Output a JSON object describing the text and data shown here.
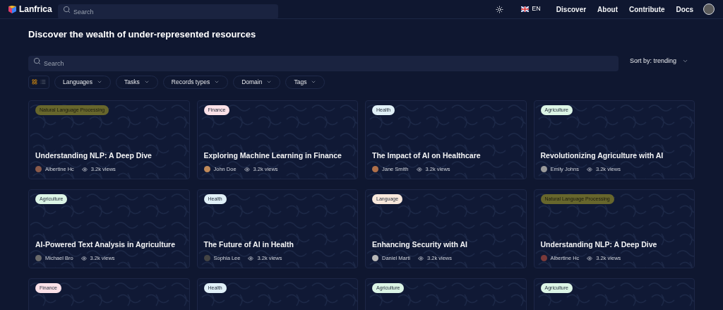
{
  "header": {
    "logo": "Lanfrica",
    "search_placeholder": "Search",
    "language": "EN",
    "nav": [
      "Discover",
      "About",
      "Contribute",
      "Docs"
    ]
  },
  "heading": "Discover the wealth of under-represented resources",
  "search": {
    "placeholder": "Search"
  },
  "sort": "Sort by: trending",
  "view_toggle": [
    {
      "kind": "grid",
      "selected": true
    },
    {
      "kind": "list",
      "selected": false
    }
  ],
  "filters": [
    "Languages",
    "Tasks",
    "Records types",
    "Domain",
    "Tags"
  ],
  "cards": [
    {
      "tag": "Natural Language Processing",
      "color": "#67662c",
      "title": "Understanding NLP: A Deep Dive",
      "author": "Albertine Hc",
      "views": "3.2k views"
    },
    {
      "tag": "Finance",
      "color": "#fbe1e8",
      "title": "Exploring Machine Learning in Finance",
      "author": "John Doe",
      "views": "3.2k views"
    },
    {
      "tag": "Health",
      "color": "#e0f0f8",
      "title": "The Impact of AI on Healthcare",
      "author": "Jane Smith",
      "views": "3.2k views"
    },
    {
      "tag": "Agriculture",
      "color": "#dcf5e6",
      "title": "Revolutionizing Agriculture with AI",
      "author": "Emily Johns",
      "views": "3.2k views"
    },
    {
      "tag": "Agriculture",
      "color": "#dcf5e6",
      "title": "AI-Powered Text Analysis in Agriculture",
      "author": "Michael Bro",
      "views": "3.2k views"
    },
    {
      "tag": "Health",
      "color": "#e0f0f8",
      "title": "The Future of AI in Health",
      "author": "Sophia Lee",
      "views": "3.2k views"
    },
    {
      "tag": "Language",
      "color": "#f8e8dc",
      "title": "Enhancing Security with AI",
      "author": "Daniel Marti",
      "views": "3.2k views"
    },
    {
      "tag": "Natural Language Processing",
      "color": "#67662c",
      "title": "Understanding NLP: A Deep Dive",
      "author": "Albertine Hc",
      "views": "3.2k views"
    },
    {
      "tag": "Finance",
      "color": "#fbe1e8"
    },
    {
      "tag": "Health",
      "color": "#e0f0f8"
    },
    {
      "tag": "Agriculture",
      "color": "#dcf5e6"
    },
    {
      "tag": "Agriculture",
      "color": "#dcf5e6"
    }
  ]
}
